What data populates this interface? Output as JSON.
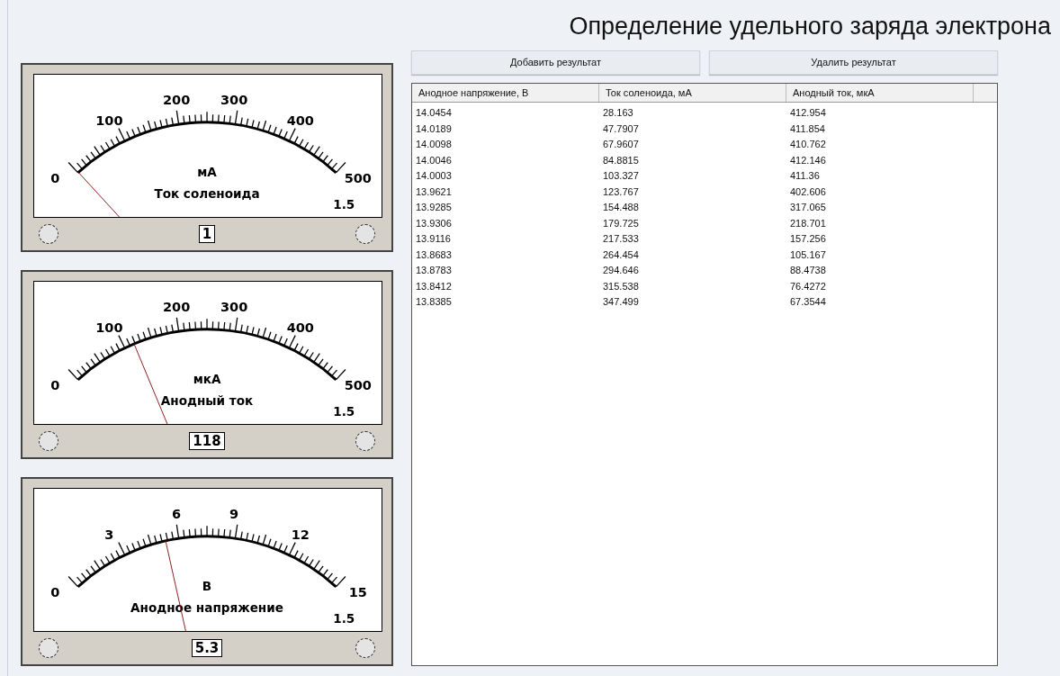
{
  "title": "Определение удельного заряда электрона",
  "meters": [
    {
      "unit": "мА",
      "name": "Ток соленоида",
      "scale": [
        "0",
        "100",
        "200",
        "300",
        "400",
        "500"
      ],
      "accuracy_class": "1.5",
      "reading": "1"
    },
    {
      "unit": "мкА",
      "name": "Анодный ток",
      "scale": [
        "0",
        "100",
        "200",
        "300",
        "400",
        "500"
      ],
      "accuracy_class": "1.5",
      "reading": "118"
    },
    {
      "unit": "В",
      "name": "Анодное напряжение",
      "scale": [
        "0",
        "3",
        "6",
        "9",
        "12",
        "15"
      ],
      "accuracy_class": "1.5",
      "reading": "5.3"
    }
  ],
  "buttons": [
    "Добавить результат",
    "Удалить результат"
  ],
  "table": {
    "columns": [
      "Анодное напряжение, В",
      "Ток соленоида, мА",
      "Анодный ток, мкА"
    ],
    "rows": [
      [
        "14.0454",
        "28.163",
        "412.954"
      ],
      [
        "14.0189",
        "47.7907",
        "411.854"
      ],
      [
        "14.0098",
        "67.9607",
        "410.762"
      ],
      [
        "14.0046",
        "84.8815",
        "412.146"
      ],
      [
        "14.0003",
        "103.327",
        "411.36"
      ],
      [
        "13.9621",
        "123.767",
        "402.606"
      ],
      [
        "13.9285",
        "154.488",
        "317.065"
      ],
      [
        "13.9306",
        "179.725",
        "218.701"
      ],
      [
        "13.9116",
        "217.533",
        "157.256"
      ],
      [
        "13.8683",
        "264.454",
        "105.167"
      ],
      [
        "13.8783",
        "294.646",
        "88.4738"
      ],
      [
        "13.8412",
        "315.538",
        "76.4272"
      ],
      [
        "13.8385",
        "347.499",
        "67.3544"
      ]
    ]
  }
}
